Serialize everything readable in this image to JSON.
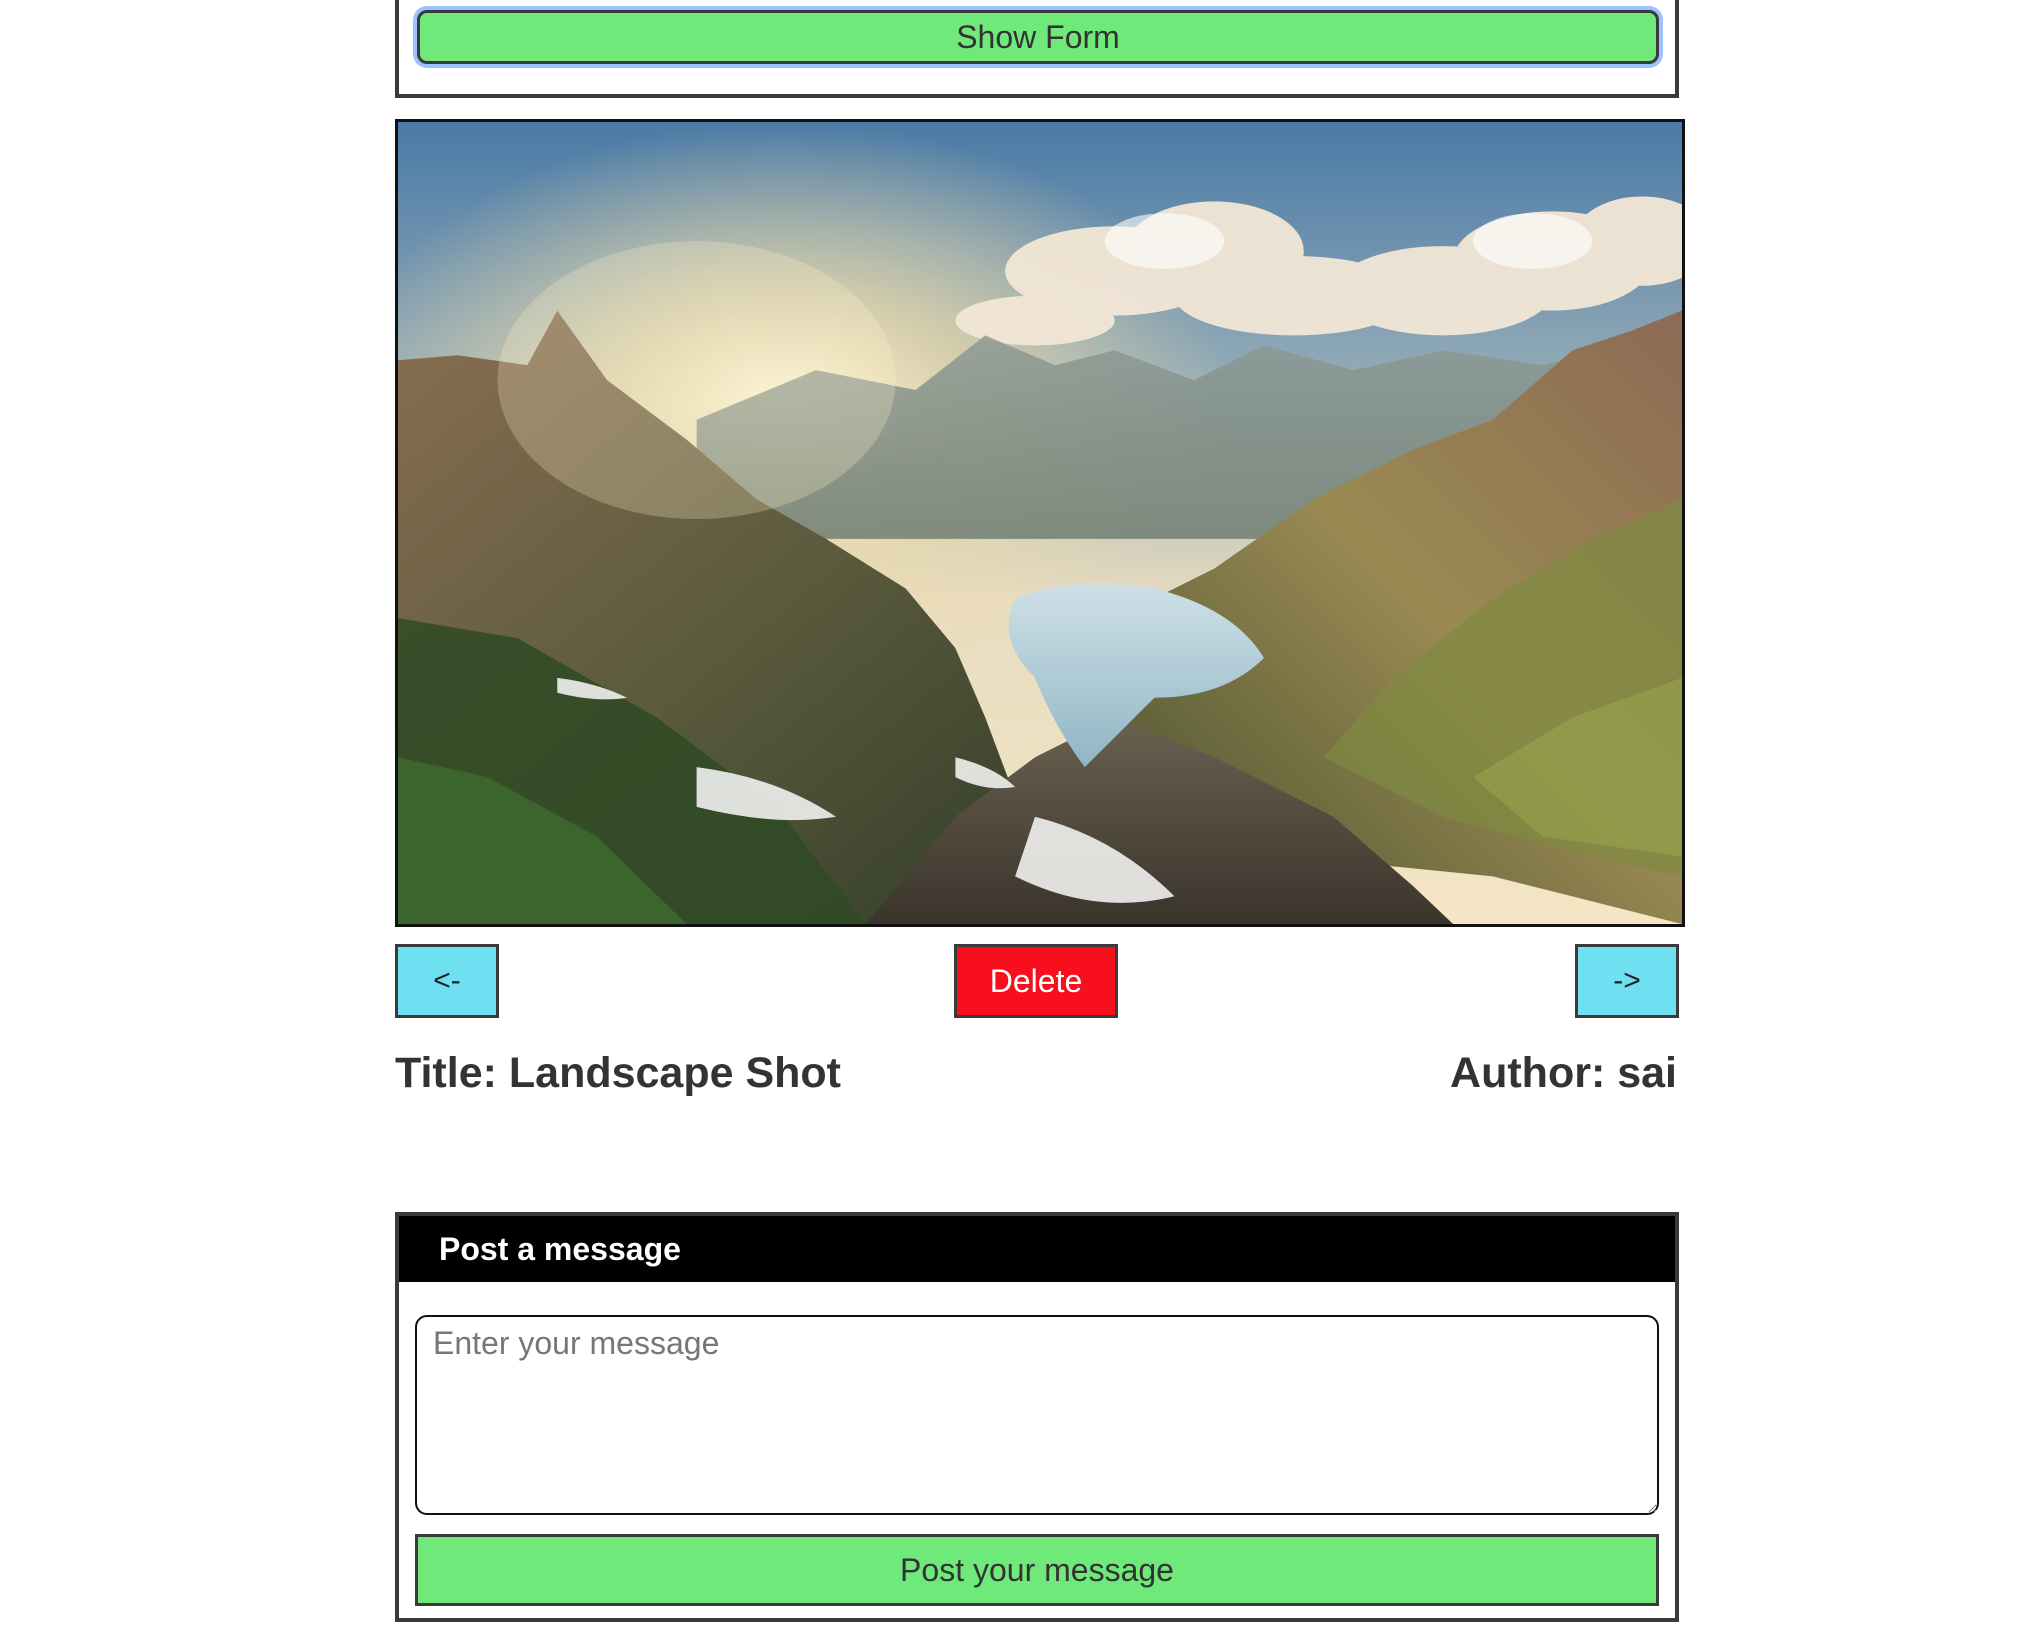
{
  "form_toggle": {
    "label": "Show Form"
  },
  "photo": {
    "subject": "mountain-landscape-image"
  },
  "navigation": {
    "prev_label": "<-",
    "delete_label": "Delete",
    "next_label": "->"
  },
  "meta": {
    "title": "Title: Landscape Shot",
    "author": "Author: sai"
  },
  "message_panel": {
    "header": "Post a message",
    "input_placeholder": "Enter your message",
    "input_value": "",
    "submit_label": "Post your message"
  },
  "colors": {
    "green_button": "#6fe97a",
    "nav_button": "#6fe0f2",
    "delete_button": "#f80f1e",
    "panel_header": "#000000",
    "border": "#3a3a3a",
    "focus_ring": "#9cc3ff"
  }
}
